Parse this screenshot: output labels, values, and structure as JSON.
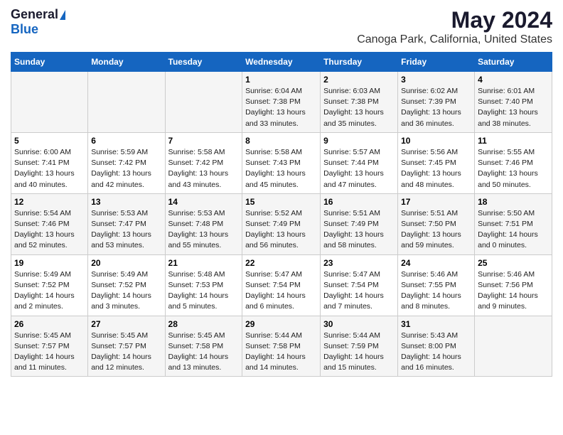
{
  "logo": {
    "general": "General",
    "blue": "Blue"
  },
  "title": "May 2024",
  "subtitle": "Canoga Park, California, United States",
  "weekdays": [
    "Sunday",
    "Monday",
    "Tuesday",
    "Wednesday",
    "Thursday",
    "Friday",
    "Saturday"
  ],
  "weeks": [
    [
      {
        "day": "",
        "info": ""
      },
      {
        "day": "",
        "info": ""
      },
      {
        "day": "",
        "info": ""
      },
      {
        "day": "1",
        "info": "Sunrise: 6:04 AM\nSunset: 7:38 PM\nDaylight: 13 hours\nand 33 minutes."
      },
      {
        "day": "2",
        "info": "Sunrise: 6:03 AM\nSunset: 7:38 PM\nDaylight: 13 hours\nand 35 minutes."
      },
      {
        "day": "3",
        "info": "Sunrise: 6:02 AM\nSunset: 7:39 PM\nDaylight: 13 hours\nand 36 minutes."
      },
      {
        "day": "4",
        "info": "Sunrise: 6:01 AM\nSunset: 7:40 PM\nDaylight: 13 hours\nand 38 minutes."
      }
    ],
    [
      {
        "day": "5",
        "info": "Sunrise: 6:00 AM\nSunset: 7:41 PM\nDaylight: 13 hours\nand 40 minutes."
      },
      {
        "day": "6",
        "info": "Sunrise: 5:59 AM\nSunset: 7:42 PM\nDaylight: 13 hours\nand 42 minutes."
      },
      {
        "day": "7",
        "info": "Sunrise: 5:58 AM\nSunset: 7:42 PM\nDaylight: 13 hours\nand 43 minutes."
      },
      {
        "day": "8",
        "info": "Sunrise: 5:58 AM\nSunset: 7:43 PM\nDaylight: 13 hours\nand 45 minutes."
      },
      {
        "day": "9",
        "info": "Sunrise: 5:57 AM\nSunset: 7:44 PM\nDaylight: 13 hours\nand 47 minutes."
      },
      {
        "day": "10",
        "info": "Sunrise: 5:56 AM\nSunset: 7:45 PM\nDaylight: 13 hours\nand 48 minutes."
      },
      {
        "day": "11",
        "info": "Sunrise: 5:55 AM\nSunset: 7:46 PM\nDaylight: 13 hours\nand 50 minutes."
      }
    ],
    [
      {
        "day": "12",
        "info": "Sunrise: 5:54 AM\nSunset: 7:46 PM\nDaylight: 13 hours\nand 52 minutes."
      },
      {
        "day": "13",
        "info": "Sunrise: 5:53 AM\nSunset: 7:47 PM\nDaylight: 13 hours\nand 53 minutes."
      },
      {
        "day": "14",
        "info": "Sunrise: 5:53 AM\nSunset: 7:48 PM\nDaylight: 13 hours\nand 55 minutes."
      },
      {
        "day": "15",
        "info": "Sunrise: 5:52 AM\nSunset: 7:49 PM\nDaylight: 13 hours\nand 56 minutes."
      },
      {
        "day": "16",
        "info": "Sunrise: 5:51 AM\nSunset: 7:49 PM\nDaylight: 13 hours\nand 58 minutes."
      },
      {
        "day": "17",
        "info": "Sunrise: 5:51 AM\nSunset: 7:50 PM\nDaylight: 13 hours\nand 59 minutes."
      },
      {
        "day": "18",
        "info": "Sunrise: 5:50 AM\nSunset: 7:51 PM\nDaylight: 14 hours\nand 0 minutes."
      }
    ],
    [
      {
        "day": "19",
        "info": "Sunrise: 5:49 AM\nSunset: 7:52 PM\nDaylight: 14 hours\nand 2 minutes."
      },
      {
        "day": "20",
        "info": "Sunrise: 5:49 AM\nSunset: 7:52 PM\nDaylight: 14 hours\nand 3 minutes."
      },
      {
        "day": "21",
        "info": "Sunrise: 5:48 AM\nSunset: 7:53 PM\nDaylight: 14 hours\nand 5 minutes."
      },
      {
        "day": "22",
        "info": "Sunrise: 5:47 AM\nSunset: 7:54 PM\nDaylight: 14 hours\nand 6 minutes."
      },
      {
        "day": "23",
        "info": "Sunrise: 5:47 AM\nSunset: 7:54 PM\nDaylight: 14 hours\nand 7 minutes."
      },
      {
        "day": "24",
        "info": "Sunrise: 5:46 AM\nSunset: 7:55 PM\nDaylight: 14 hours\nand 8 minutes."
      },
      {
        "day": "25",
        "info": "Sunrise: 5:46 AM\nSunset: 7:56 PM\nDaylight: 14 hours\nand 9 minutes."
      }
    ],
    [
      {
        "day": "26",
        "info": "Sunrise: 5:45 AM\nSunset: 7:57 PM\nDaylight: 14 hours\nand 11 minutes."
      },
      {
        "day": "27",
        "info": "Sunrise: 5:45 AM\nSunset: 7:57 PM\nDaylight: 14 hours\nand 12 minutes."
      },
      {
        "day": "28",
        "info": "Sunrise: 5:45 AM\nSunset: 7:58 PM\nDaylight: 14 hours\nand 13 minutes."
      },
      {
        "day": "29",
        "info": "Sunrise: 5:44 AM\nSunset: 7:58 PM\nDaylight: 14 hours\nand 14 minutes."
      },
      {
        "day": "30",
        "info": "Sunrise: 5:44 AM\nSunset: 7:59 PM\nDaylight: 14 hours\nand 15 minutes."
      },
      {
        "day": "31",
        "info": "Sunrise: 5:43 AM\nSunset: 8:00 PM\nDaylight: 14 hours\nand 16 minutes."
      },
      {
        "day": "",
        "info": ""
      }
    ]
  ]
}
